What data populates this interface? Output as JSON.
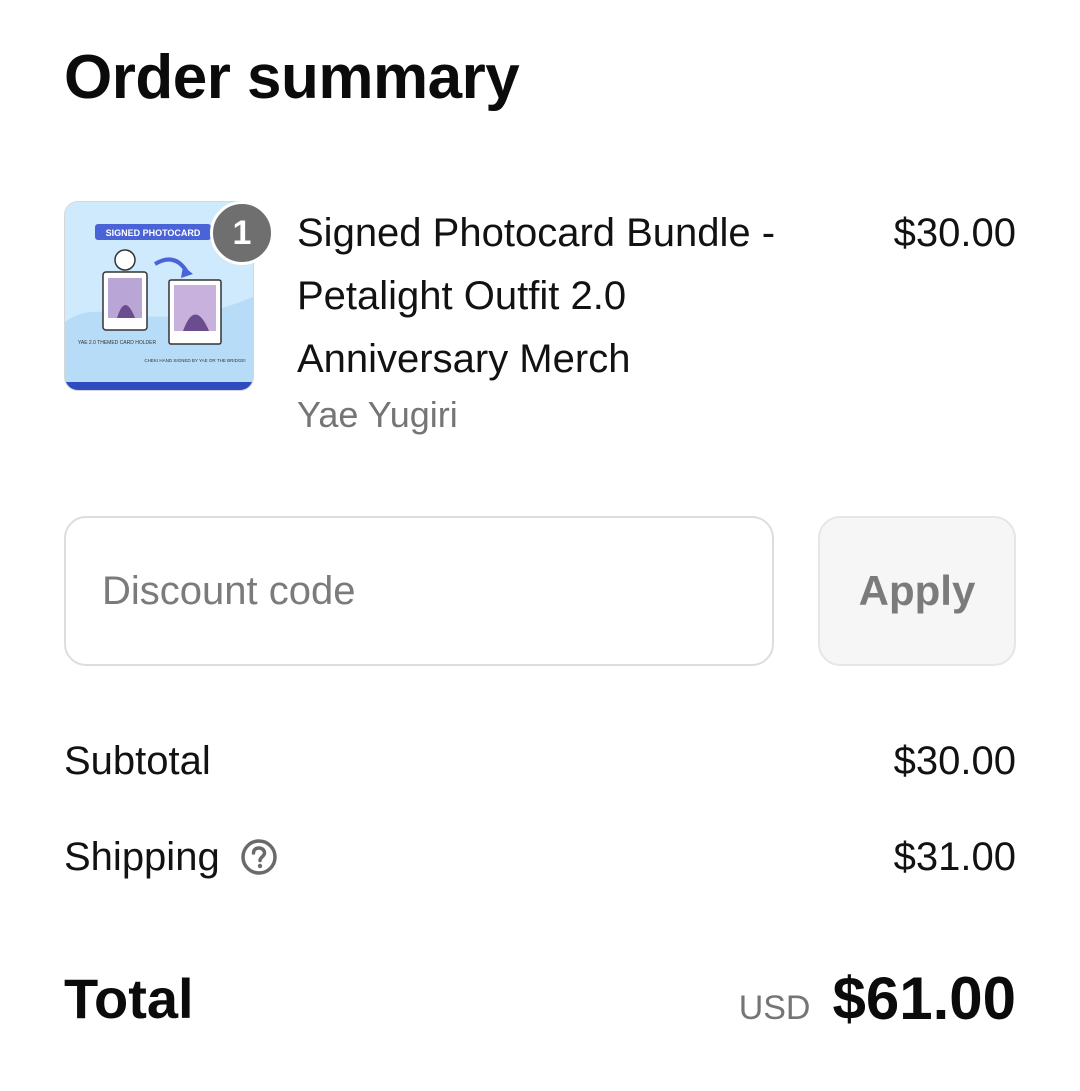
{
  "title": "Order summary",
  "product": {
    "quantity": "1",
    "name": "Signed Photocard Bundle - Petalight Outfit 2.0 Anniversary Merch",
    "variant": "Yae Yugiri",
    "price": "$30.00",
    "image_banner_text": "SIGNED PHOTOCARD",
    "image_caption_left": "YAE 2.0 THEMED CARD HOLDER",
    "image_caption_right": "CHEKI HAND SIGNED BY YAE OR THE BRIDGE!"
  },
  "discount": {
    "placeholder": "Discount code",
    "apply_label": "Apply"
  },
  "summary": {
    "subtotal_label": "Subtotal",
    "subtotal_value": "$30.00",
    "shipping_label": "Shipping",
    "shipping_value": "$31.00",
    "total_label": "Total",
    "currency": "USD",
    "total_value": "$61.00"
  },
  "colors": {
    "badge": "#6f6f6f",
    "muted_text": "#757575",
    "border": "#dddddd",
    "button_bg": "#f6f6f6"
  },
  "icons": {
    "shipping_help": "question-circle-icon"
  }
}
